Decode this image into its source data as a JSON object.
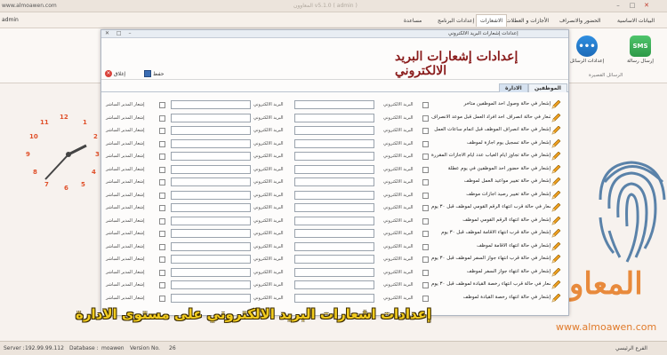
{
  "window": {
    "url": "www.almoawen.com",
    "title": "المعاوون v5.1.0 ( admin )",
    "minimize": "–",
    "maximize": "□",
    "close": "✕"
  },
  "menubar": {
    "user": "admin",
    "items": [
      {
        "label": "البيانات الاساسية"
      },
      {
        "label": "الحضور والانصراف"
      },
      {
        "label": "الأجازات و العطلات"
      },
      {
        "label": "الاشعارات"
      },
      {
        "label": "إعدادات البرنامج"
      },
      {
        "label": "مساعدة"
      }
    ]
  },
  "ribbon": {
    "send_sms": "إرسال رسالة",
    "sms_settings": "إعدادات الرسائل",
    "sms_icon": "SMS",
    "group": "الرسائل القصيرة"
  },
  "dialog": {
    "title": "إعدادات إشعارات البريد الالكتروني",
    "heading": "إعدادات إشعارات البريد الالكتروني",
    "toolbar": {
      "save": "حفظ",
      "close": "إغلاق"
    },
    "tabs": [
      "الموظفين",
      "الادارة"
    ],
    "email_label": "البريد الالكتروني",
    "notify_label": "إشعار المدير المباشر",
    "rows": [
      {
        "label": "إشعار في حالة وصول احد الموظفين متأخر"
      },
      {
        "label": "إشعار في حالة انصراف احد افراد العمل قبل موعد الانصراف"
      },
      {
        "label": "إشعار في حالة انصراف الموظف قبل اتمام ساعات العمل"
      },
      {
        "label": "إشعار في حالة تسجيل يوم اجازة لموظف"
      },
      {
        "label": "إشعار في حالة تجاوز ايام الغياب عدد ايام الاجازات المقررة"
      },
      {
        "label": "إشعار في حالة حضور احد الموظفين في يوم عطلة"
      },
      {
        "label": "إشعار في حالة تغيير مواعيد العمل لموظف"
      },
      {
        "label": "إشعار في حالة تغيير رصيد اجازات موظف"
      },
      {
        "label": "إشعار في حالة قرب انتهاء الرقم القومي لموظف قبل ٣٠ يوم"
      },
      {
        "label": "إشعار في حالة انتهاء الرقم القومي لموظف"
      },
      {
        "label": "إشعار في حالة قرب انتهاء الاقامة لموظف قبل ٣٠ يوم"
      },
      {
        "label": "إشعار في حالة انتهاء الاقامة لموظف"
      },
      {
        "label": "إشعار في حالة قرب انتهاء جواز السفر لموظف قبل ٣٠ يوم"
      },
      {
        "label": "إشعار في حالة انتهاء جواز السفر لموظف"
      },
      {
        "label": "إشعار في حالة قرب انتهاء رخصة القيادة لموظف قبل ٣٠ يوم"
      },
      {
        "label": "إشعار في حالة انتهاء رخصة القيادة لموظف"
      }
    ]
  },
  "background": {
    "clock_numbers": [
      "12",
      "1",
      "2",
      "3",
      "4",
      "5",
      "6",
      "7",
      "8",
      "9",
      "10",
      "11"
    ],
    "logo": "المعاو",
    "site": "www.almoawen.com"
  },
  "caption": "إعدادات اشعارات البريد الالكتروني على مستوى الادارة",
  "statusbar": {
    "server_label": "Server :",
    "server": "192.99.99.112",
    "database_label": "Database :",
    "database": "moawen",
    "version_label": "Version No.",
    "version": "26",
    "branch": "الفرع الرئيسي"
  }
}
